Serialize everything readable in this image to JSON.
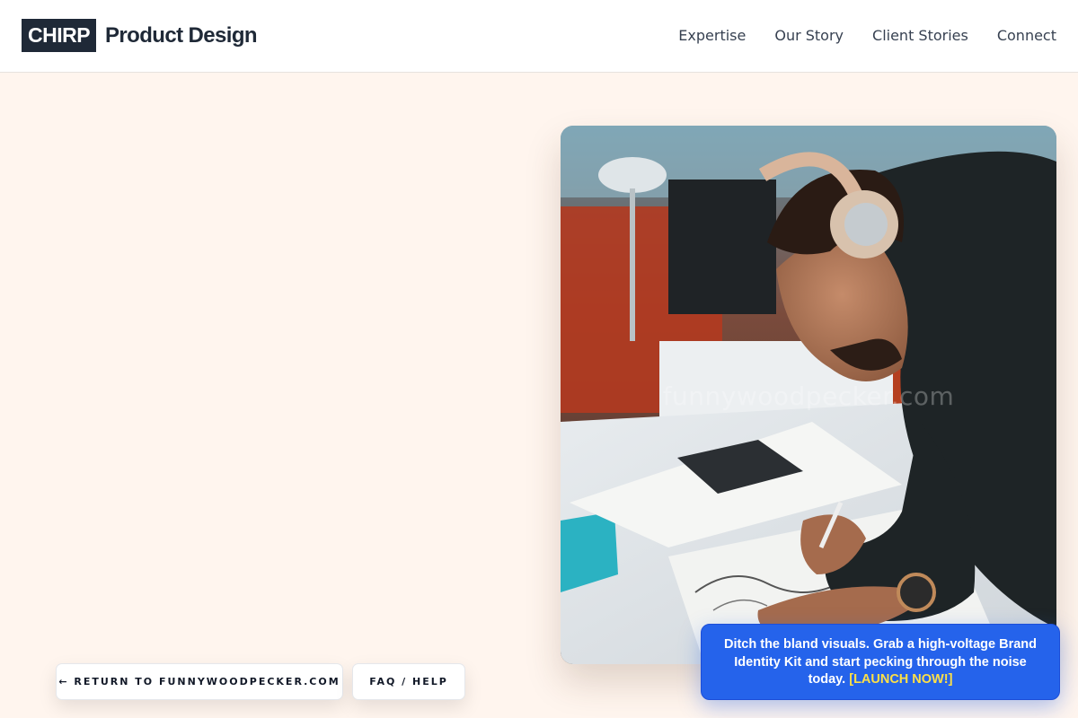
{
  "header": {
    "logo_box": "CHIRP",
    "logo_text": "Product Design",
    "nav": [
      "Expertise",
      "Our Story",
      "Client Stories",
      "Connect"
    ]
  },
  "hero": {
    "image_alt": "Designer wearing headphones sketching at a desk",
    "watermark": "funnywoodpecker.com"
  },
  "buttons": {
    "return_label": "← RETURN TO FUNNYWOODPECKER.COM",
    "faq_label": "FAQ / HELP"
  },
  "promo": {
    "text": "Ditch the bland visuals. Grab a high-voltage Brand Identity Kit and start pecking through the noise today.",
    "cta": "[LAUNCH NOW!]"
  },
  "colors": {
    "page_bg": "#fff5ee",
    "logo_bg": "#1f2937",
    "promo_bg": "#2563eb",
    "promo_cta": "#fde047"
  }
}
